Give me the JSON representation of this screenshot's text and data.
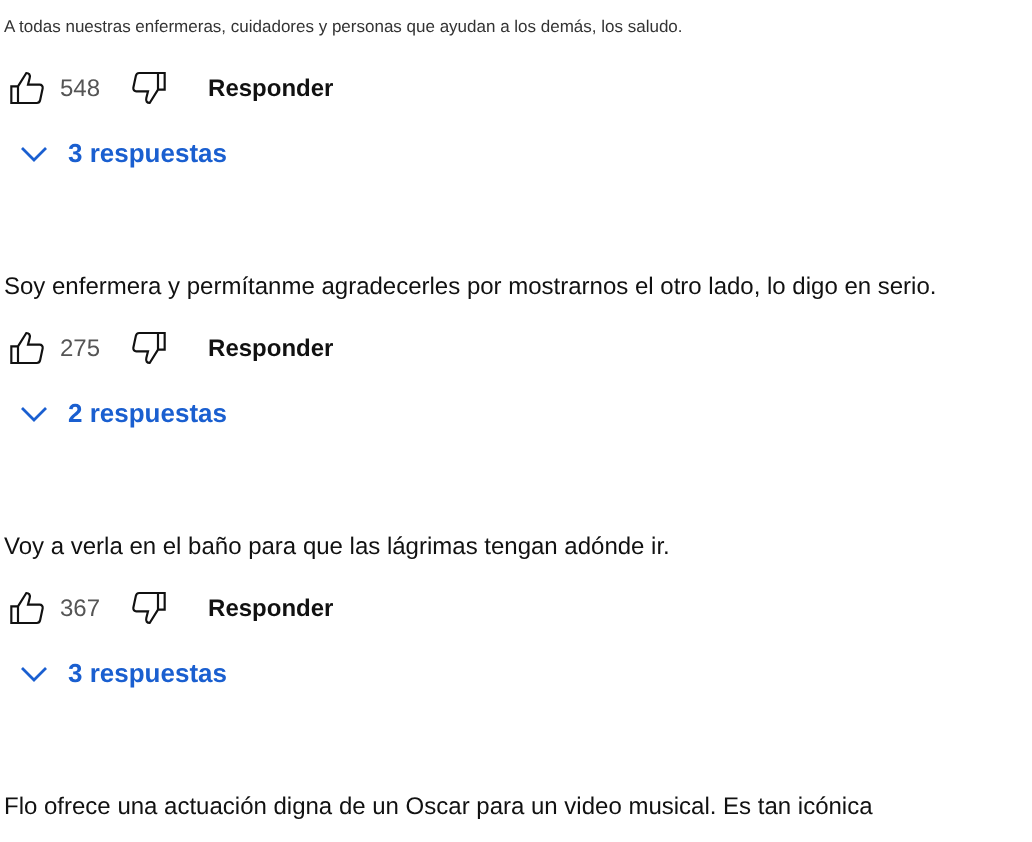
{
  "comments": [
    {
      "kind": "small",
      "text": "A todas nuestras enfermeras, cuidadores y personas que ayudan a los demás, los saludo.",
      "likes": "548",
      "reply_label": "Responder",
      "replies": "3 respuestas"
    },
    {
      "kind": "normal",
      "text": "Soy enfermera y permítanme agradecerles por mostrarnos el otro lado, lo digo en serio.",
      "likes": "275",
      "reply_label": "Responder",
      "replies": "2 respuestas"
    },
    {
      "kind": "normal",
      "text": "Voy a verla en el baño para que las lágrimas tengan adónde ir.",
      "likes": "367",
      "reply_label": "Responder",
      "replies": "3 respuestas"
    },
    {
      "kind": "normal",
      "text": "Flo ofrece una actuación digna de un Oscar para un video musical. Es tan icónica"
    }
  ]
}
